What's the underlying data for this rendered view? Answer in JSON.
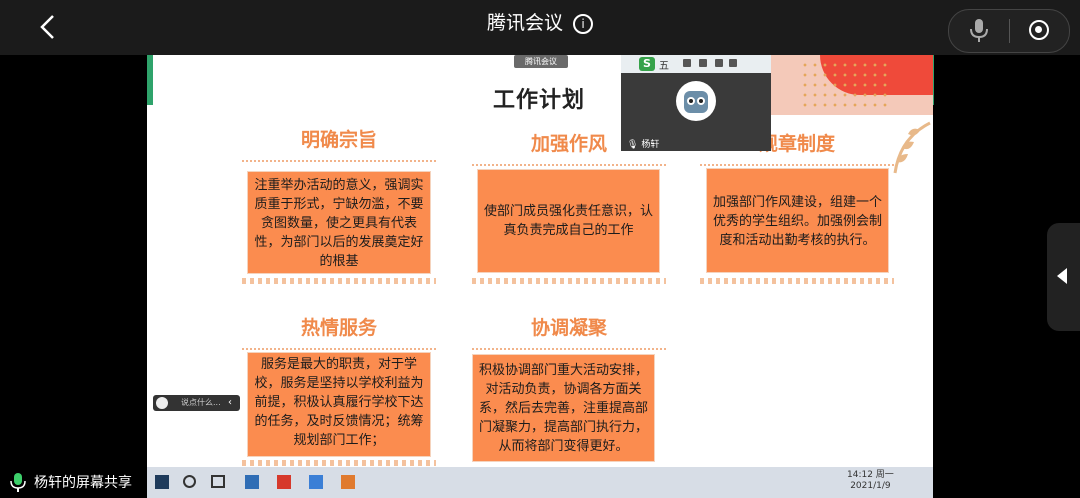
{
  "app": {
    "title": "腾讯会议",
    "info_icon": "info-icon",
    "back_icon": "chevron-left-icon",
    "mic_icon": "microphone-icon",
    "record_icon": "record-icon"
  },
  "slide": {
    "title": "工作计划",
    "cards": [
      {
        "heading": "明确宗旨",
        "body": "注重举办活动的意义，强调实质重于形式，宁缺勿滥，不要贪图数量，使之更具有代表性，为部门以后的发展奠定好的根基"
      },
      {
        "heading": "加强作风",
        "body": "使部门成员强化责任意识，认真负责完成自己的工作"
      },
      {
        "heading": "规章制度",
        "body": "加强部门作风建设，组建一个优秀的学生组织。加强例会制度和活动出勤考核的执行。"
      },
      {
        "heading": "热情服务",
        "body": "服务是最大的职责，对于学校，服务是坚持以学校利益为前提，积极认真履行学校下达的任务，及时反馈情况；统筹规划部门工作；"
      },
      {
        "heading": "协调凝聚",
        "body": "积极协调部门重大活动安排，对活动负责，协调各方面关系，然后去完善，注重提高部门凝聚力，提高部门执行力，从而将部门变得更好。"
      }
    ]
  },
  "camera": {
    "name": "杨轩",
    "toolbar_text": "五",
    "meeting_tag": "腾讯会议"
  },
  "chat": {
    "placeholder": "说点什么..."
  },
  "taskbar": {
    "time": "14:12 周一",
    "date": "2021/1/9"
  },
  "footer": {
    "share_label": "杨轩的屏幕共享"
  },
  "colors": {
    "accent_orange": "#fb8c4f",
    "heading_orange": "#f08a4b",
    "topbar": "#1b1b1b"
  }
}
